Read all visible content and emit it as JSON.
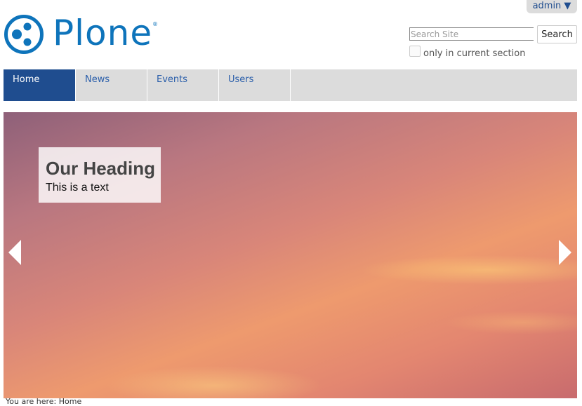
{
  "header": {
    "user_menu": "admin ▼",
    "logo_text": "Plone",
    "logo_reg": "®",
    "brand_color": "#0e74bb"
  },
  "search": {
    "placeholder": "Search Site",
    "value": "",
    "button_label": "Search",
    "section_label": "only in current section",
    "section_checked": false
  },
  "nav": {
    "items": [
      {
        "label": "Home",
        "active": true
      },
      {
        "label": "News",
        "active": false
      },
      {
        "label": "Events",
        "active": false
      },
      {
        "label": "Users",
        "active": false
      }
    ],
    "active_color": "#1f4d8f",
    "bar_color": "#dcdcdc"
  },
  "carousel": {
    "heading": "Our Heading",
    "text": "This is a text",
    "prev_icon": "chevron-left-icon",
    "next_icon": "chevron-right-icon"
  },
  "footer": {
    "snippet": "You are here: Home"
  }
}
